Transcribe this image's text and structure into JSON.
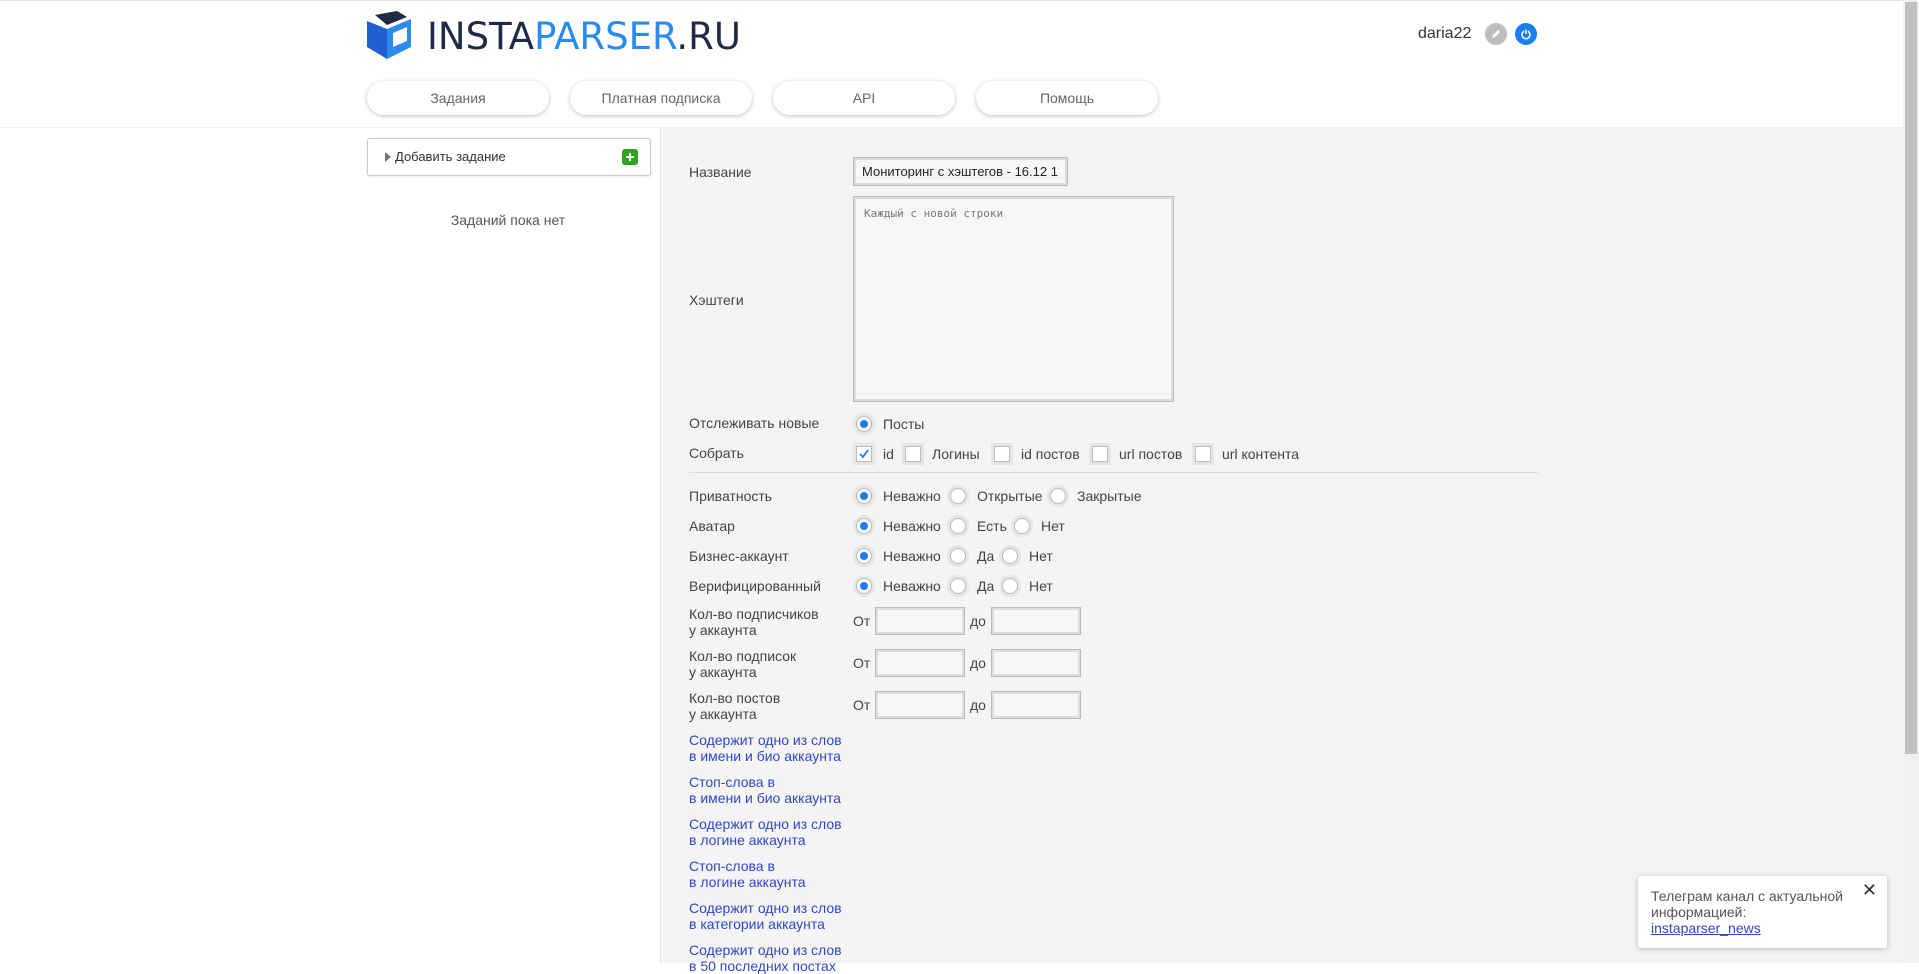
{
  "header": {
    "logo": {
      "part1": "INSTA",
      "part2": "PARSER",
      "part3": ".RU"
    },
    "username": "daria22"
  },
  "nav": [
    {
      "label": "Задания"
    },
    {
      "label": "Платная подписка"
    },
    {
      "label": "API"
    },
    {
      "label": "Помощь"
    }
  ],
  "sidebar": {
    "add_task": "Добавить задание",
    "empty": "Заданий пока нет"
  },
  "form": {
    "name_label": "Название",
    "name_value": "Мониторинг с хэштегов - 16.12 1",
    "hashtags_label": "Хэштеги",
    "hashtags_placeholder": "Каждый с новой строки",
    "track_label": "Отслеживать новые",
    "track_option": "Посты",
    "collect_label": "Собрать",
    "collect_options": [
      "id",
      "Логины",
      "id постов",
      "url постов",
      "url контента"
    ],
    "privacy_label": "Приватность",
    "privacy_options": [
      "Неважно",
      "Открытые",
      "Закрытые"
    ],
    "avatar_label": "Аватар",
    "avatar_options": [
      "Неважно",
      "Есть",
      "Нет"
    ],
    "business_label": "Бизнес-аккаунт",
    "business_options": [
      "Неважно",
      "Да",
      "Нет"
    ],
    "verified_label": "Верифицированный",
    "verified_options": [
      "Неважно",
      "Да",
      "Нет"
    ],
    "ranges": [
      {
        "line1": "Кол-во подписчиков",
        "line2": "у аккаунта",
        "from": "От",
        "to": "до"
      },
      {
        "line1": "Кол-во подписок",
        "line2": "у аккаунта",
        "from": "От",
        "to": "до"
      },
      {
        "line1": "Кол-во постов",
        "line2": "у аккаунта",
        "from": "От",
        "to": "до"
      }
    ],
    "links": [
      {
        "line1": "Содержит одно из слов",
        "line2": "в имени и био аккаунта"
      },
      {
        "line1": "Стоп-слова в",
        "line2": "в имени и био аккаунта"
      },
      {
        "line1": "Содержит одно из слов",
        "line2": "в логине аккаунта"
      },
      {
        "line1": "Стоп-слова в",
        "line2": "в логине аккаунта"
      },
      {
        "line1": "Содержит одно из слов",
        "line2": "в категории аккаунта"
      },
      {
        "line1": "Содержит одно из слов",
        "line2": "в 50 последних постах"
      }
    ]
  },
  "toast": {
    "text": "Телеграм канал с актуальной информацией:",
    "link": "instaparser_news",
    "close": "✕"
  },
  "colors": {
    "accent": "#1b7ef0",
    "link": "#2f46c9",
    "add_green": "#2ea31b",
    "logo_dark": "#1f2a44",
    "logo_blue": "#2a8af0"
  }
}
